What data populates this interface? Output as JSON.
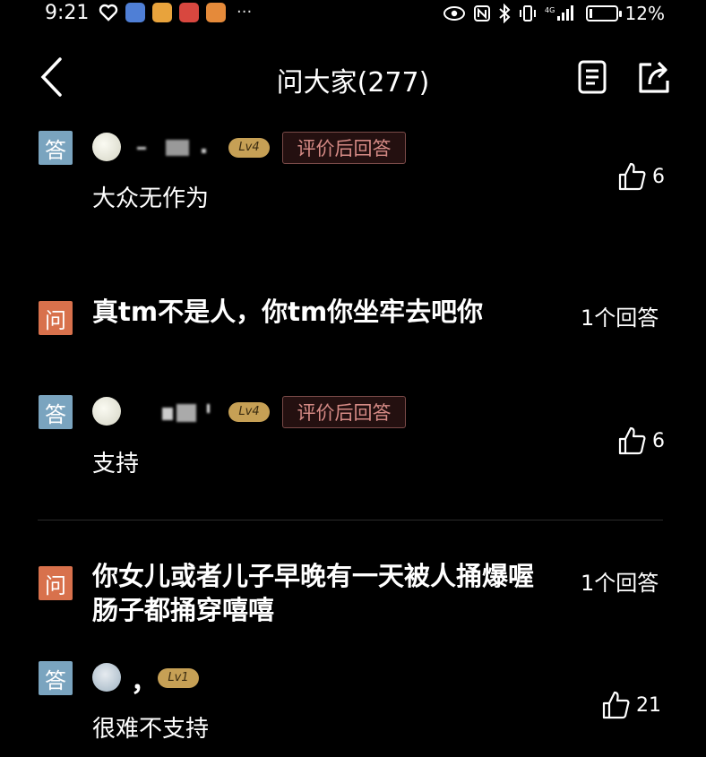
{
  "status": {
    "time": "9:21",
    "battery": "12%",
    "battery_level": 0.12
  },
  "header": {
    "title": "问大家(277)"
  },
  "icons": {
    "back": "chevron-left-icon",
    "doc": "document-icon",
    "share": "share-icon",
    "like": "thumbs-up-icon",
    "eye": "eye-icon",
    "nfc": "nfc-icon",
    "bluetooth": "bluetooth-icon",
    "vibrate": "vibrate-icon",
    "signal": "signal-icon"
  },
  "labels": {
    "answer_badge": "答",
    "question_badge": "问"
  },
  "colors": {
    "answer_badge": "#7aa4bf",
    "question_badge": "#d8714c",
    "level_badge": "#c6a055",
    "review_text": "#d58a85"
  },
  "first_answer": {
    "level": "Lv4",
    "review_label": "评价后回答",
    "text": "大众无作为",
    "likes": "6"
  },
  "questions": [
    {
      "text": "真tm不是人，你tm你坐牢去吧你",
      "answer_count": "1个回答",
      "answer": {
        "level": "Lv4",
        "review_label": "评价后回答",
        "text": "支持",
        "likes": "6"
      }
    },
    {
      "text": "你女儿或者儿子早晚有一天被人捅爆喔 肠子都捅穿嘻嘻",
      "answer_count": "1个回答",
      "answer": {
        "level": "Lv1",
        "name_visible": "，",
        "text": "很难不支持",
        "likes": "21"
      }
    }
  ]
}
